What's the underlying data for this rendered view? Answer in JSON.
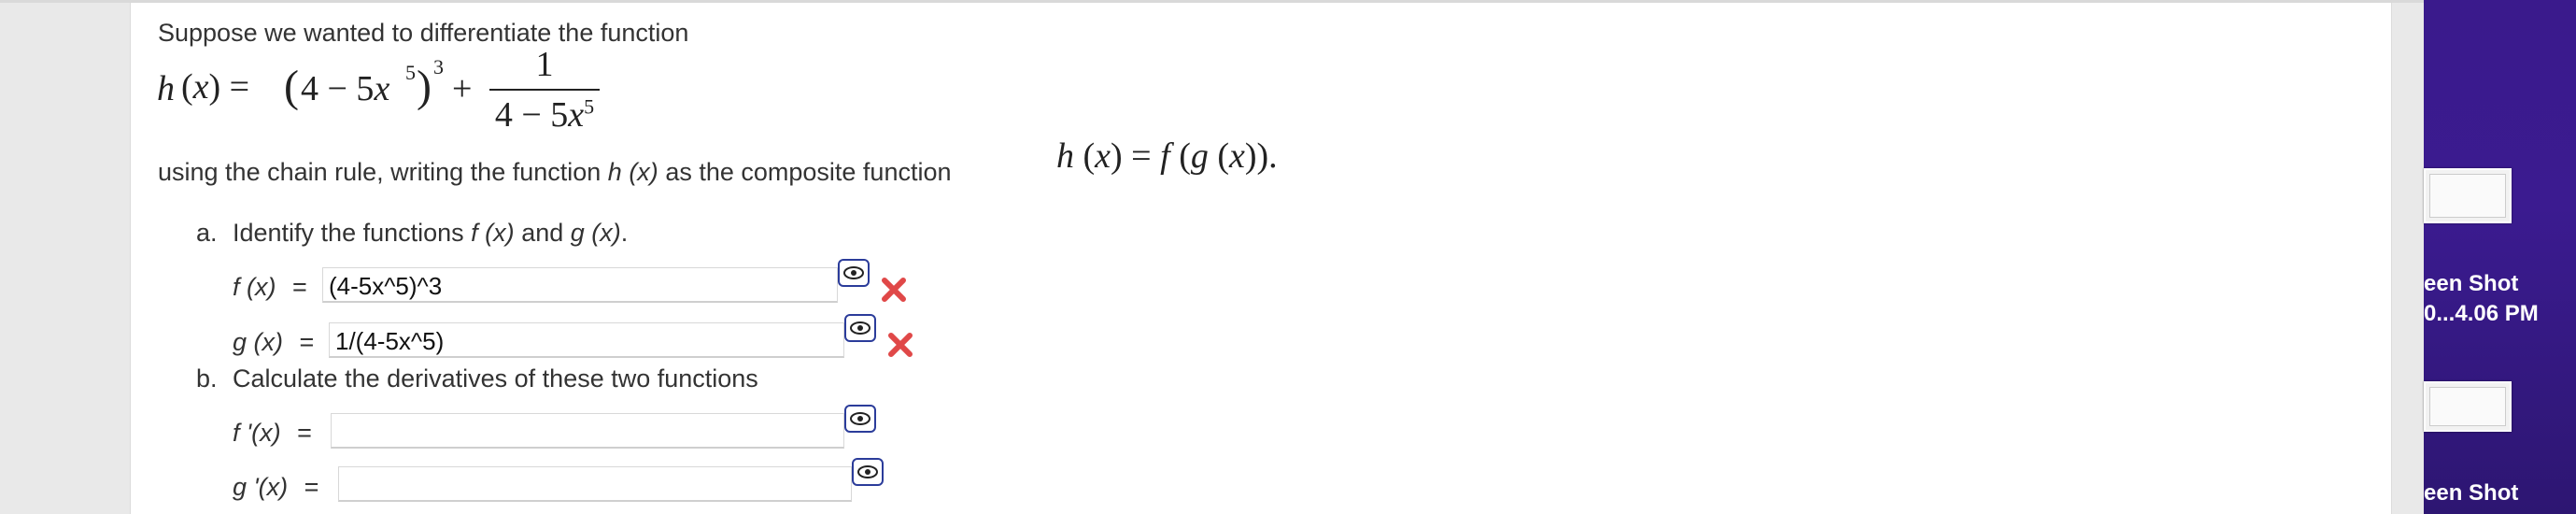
{
  "problem": {
    "intro": "Suppose we wanted to differentiate the function",
    "using_text": "using the chain rule, writing the function",
    "using_func": "h (x)",
    "using_text2": "as the composite function"
  },
  "part_a": {
    "marker": "a.",
    "text": "Identify the functions",
    "f_name": "f (x)",
    "and": "and",
    "g_name": "g (x)",
    "period": ".",
    "f_label": "f (x)",
    "f_eq": "=",
    "f_value": "(4-5x^5)^3",
    "g_label": "g (x)",
    "g_eq": "=",
    "g_value": "1/(4-5x^5)"
  },
  "part_b": {
    "marker": "b.",
    "text": "Calculate the derivatives of these two functions",
    "fp_label": "f '(x)",
    "fp_eq": "=",
    "fp_value": "",
    "gp_label": "g '(x)",
    "gp_eq": "=",
    "gp_value": ""
  },
  "sidebar": {
    "thumb1_label_line1": "een Shot",
    "thumb1_label_line2": "0...4.06 PM",
    "thumb2_label_line1": "een Shot"
  },
  "icons": [
    "preview-eye-icon",
    "incorrect-x-icon"
  ],
  "colors": {
    "incorrect": "#e04848",
    "preview_border": "#2b3c9a",
    "sidebar": "#3a1a8c"
  }
}
